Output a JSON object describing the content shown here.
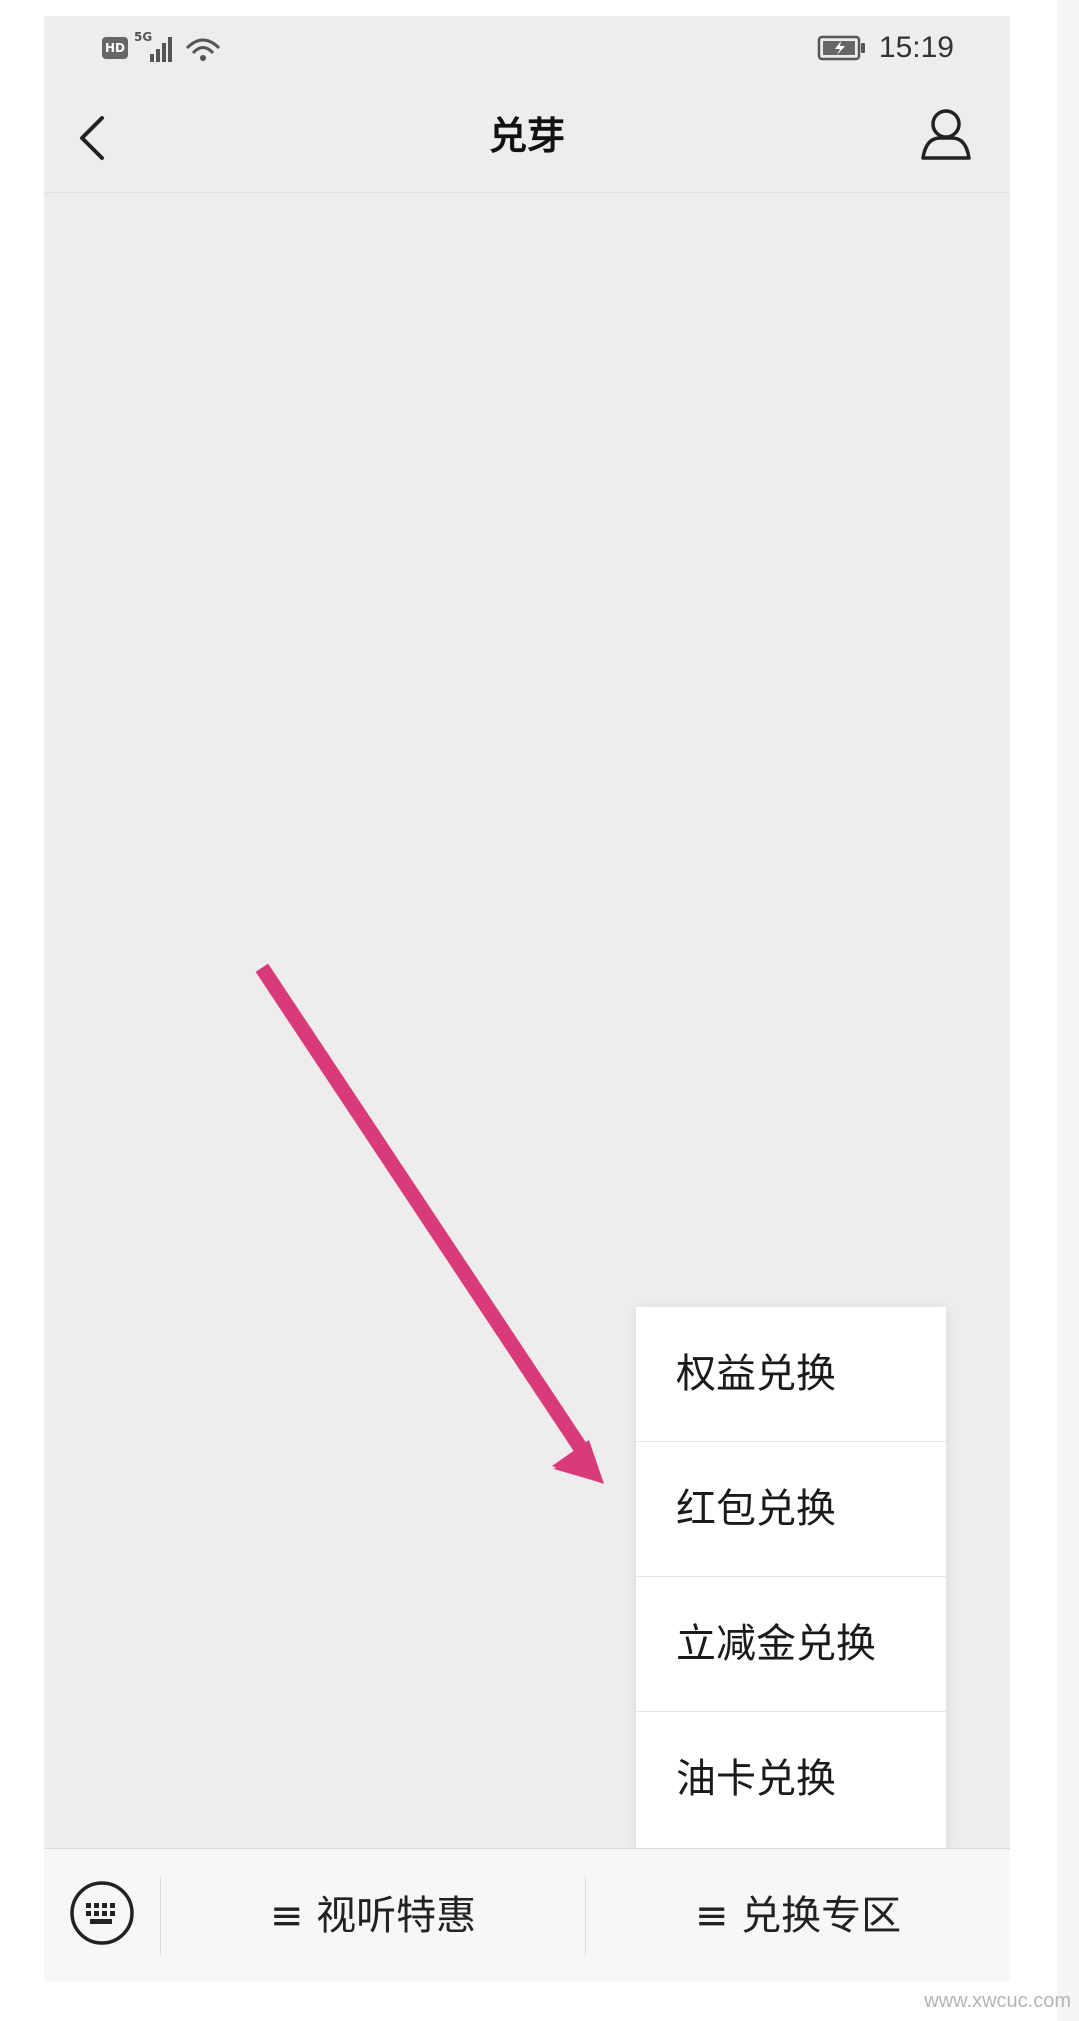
{
  "status_bar": {
    "hd_label": "HD",
    "network_label": "5G",
    "time": "15:19"
  },
  "nav": {
    "title": "兑芽"
  },
  "popup_menu": {
    "items": [
      {
        "label": "权益兑换"
      },
      {
        "label": "红包兑换"
      },
      {
        "label": "立减金兑换"
      },
      {
        "label": "油卡兑换"
      }
    ]
  },
  "bottom_bar": {
    "tabs": [
      {
        "label": "≡ 视听特惠"
      },
      {
        "label": "≡ 兑换专区"
      }
    ]
  },
  "watermark": "www.xwcuc.com",
  "colors": {
    "background": "#ededed",
    "annotation_arrow": "#d93a7a",
    "menu_background": "#ffffff"
  }
}
